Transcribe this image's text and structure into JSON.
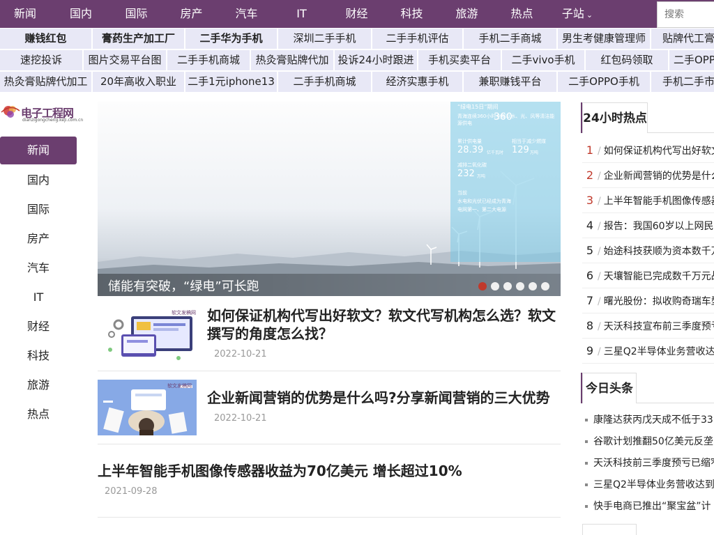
{
  "topnav": {
    "items": [
      "新闻",
      "国内",
      "国际",
      "房产",
      "汽车",
      "IT",
      "财经",
      "科技",
      "旅游",
      "热点",
      "子站"
    ],
    "search_placeholder": "搜索"
  },
  "links": {
    "row1": [
      "赚钱红包",
      "膏药生产加工厂",
      "二手华为手机",
      "深圳二手手机",
      "二手手机评估",
      "手机二手商城",
      "男生考健康管理师",
      "贴牌代工膏"
    ],
    "row2": [
      "速挖投诉",
      "图片交易平台图",
      "二手手机商城",
      "热灸膏贴牌代加",
      "投诉24小时跟进",
      "手机买卖平台",
      "二手vivo手机",
      "红包码领取",
      "二手OPP"
    ],
    "row3": [
      "热灸膏贴牌代加工",
      "20年高收入职业",
      "二手1元iphone13",
      "二手手机商城",
      "经济实惠手机",
      "兼职赚钱平台",
      "二手OPPO手机",
      "手机二手市"
    ]
  },
  "logo": {
    "text": "电子工程网",
    "sub": "dianzigongcheng.keji.com.cn"
  },
  "leftnav": [
    "新闻",
    "国内",
    "国际",
    "房产",
    "汽车",
    "IT",
    "财经",
    "科技",
    "旅游",
    "热点"
  ],
  "hero": {
    "caption": "储能有突破，“绿电”可长跑",
    "slide_count": 6,
    "active_slide": 1,
    "infographic": {
      "headline": "“绿电15日”期间",
      "intro": "青海连续360小时全部以水、光、风等清洁能源供电",
      "big_number": "360",
      "stat1_label": "累计供电量",
      "stat1_value": "28.39",
      "stat1_unit": "亿千瓦时",
      "stat2_label": "相当于减少燃煤",
      "stat2_value": "129",
      "stat2_unit": "万吨",
      "stat3_label": "减排二氧化碳",
      "stat3_value": "232",
      "stat3_unit": "万吨",
      "note1": "当前",
      "note2": "水电和光伏已经成为青海",
      "note3": "电网第一、第二大电源"
    }
  },
  "articles": [
    {
      "title": "如何保证机构代写出好软文？软文代写机构怎么选？软文撰写的角度怎么找？",
      "date": "2022-10-21",
      "thumb_label": "软文发稿网"
    },
    {
      "title": "企业新闻营销的优势是什么吗?分享新闻营销的三大优势",
      "date": "2022-10-21",
      "thumb_label": "软文发稿网"
    },
    {
      "title": "上半年智能手机图像传感器收益为70亿美元 增长超过10%",
      "date": "2021-09-28"
    }
  ],
  "hot24": {
    "title": "24小时热点",
    "items": [
      "如何保证机构代写出好软文",
      "企业新闻营销的优势是什么",
      "上半年智能手机图像传感器",
      "报告：我国60岁以上网民",
      "始途科技获顺为资本数千万",
      "天壤智能已完成数千万元战",
      "曙光股份：拟收购奇瑞车型",
      "天沃科技宣布前三季度预亏",
      "三星Q2半导体业务营收达"
    ]
  },
  "headlines": {
    "title": "今日头条",
    "items": [
      "康隆达获丙戊天成不低于33.",
      "谷歌计划推翻50亿美元反垄断",
      "天沃科技前三季度预亏已缩窄",
      "三星Q2半导体业务营收达到",
      "快手电商已推出“聚宝盆”计"
    ]
  },
  "colors": {
    "brand": "#6b3e6f",
    "link_bg": "#e8e8f6",
    "accent_red": "#c0392b"
  }
}
